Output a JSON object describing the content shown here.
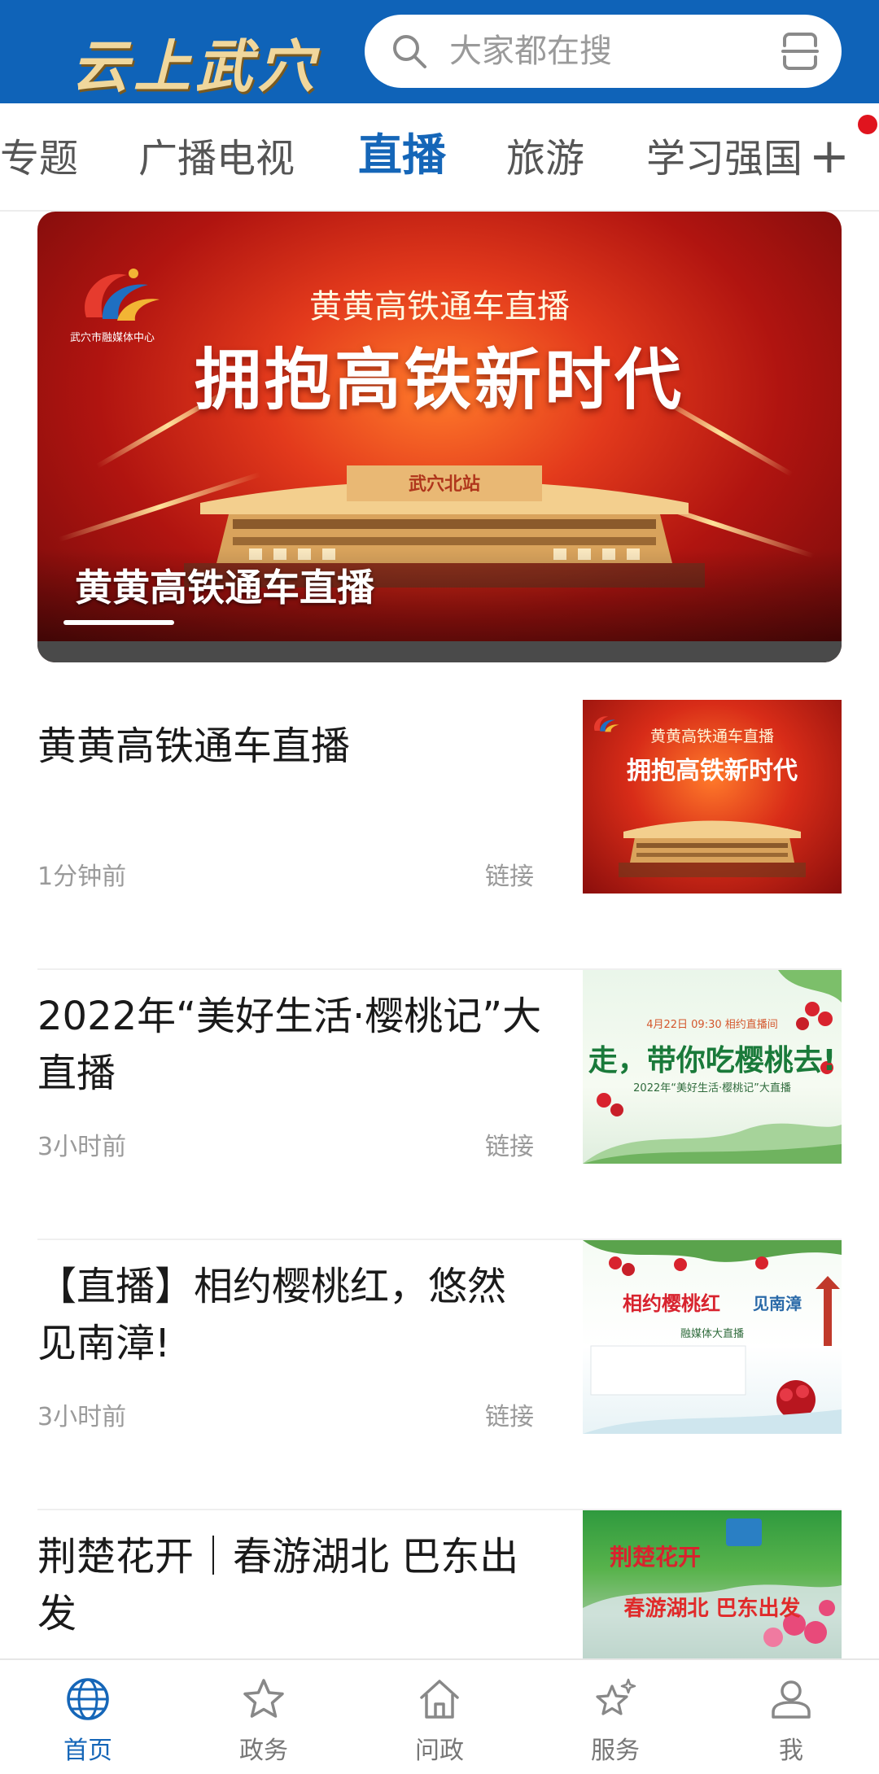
{
  "header": {
    "logo_text": "云上武穴",
    "search_placeholder": "大家都在搜"
  },
  "tabs": [
    {
      "label": "专题",
      "active": false
    },
    {
      "label": "广播电视",
      "active": false
    },
    {
      "label": "直播",
      "active": true
    },
    {
      "label": "旅游",
      "active": false
    },
    {
      "label": "学习强国",
      "active": false
    }
  ],
  "tabs_add": "+",
  "banner": {
    "logo_text": "武穴市融媒体中心",
    "subtitle": "黄黄高铁通车直播",
    "title": "拥抱高铁新时代",
    "station_sign": "武穴北站",
    "caption": "黄黄高铁通车直播"
  },
  "news": [
    {
      "title": "黄黄高铁通车直播",
      "time": "1分钟前",
      "tag": "链接",
      "thumb": {
        "line1": "黄黄高铁通车直播",
        "line2": "拥抱高铁新时代"
      }
    },
    {
      "title": "2022年“美好生活·樱桃记”大直播",
      "time": "3小时前",
      "tag": "链接",
      "thumb": {
        "line1": "4月22日 09:30 相约直播间",
        "line2": "走，带你吃樱桃去!",
        "line3": "2022年“美好生活·樱桃记”大直播"
      }
    },
    {
      "title": "【直播】相约樱桃红，悠然见南漳!",
      "time": "3小时前",
      "tag": "链接",
      "thumb": {
        "line1": "相约樱桃红",
        "line2": "见南漳",
        "line3": "融媒体大直播"
      }
    },
    {
      "title": "荆楚花开｜春游湖北 巴东出发",
      "time": "",
      "tag": "",
      "thumb": {
        "line1": "荆楚花开",
        "line2": "春游湖北 巴东出发"
      }
    }
  ],
  "bottom_nav": [
    {
      "label": "首页",
      "icon": "globe-icon",
      "active": true
    },
    {
      "label": "政务",
      "icon": "star-icon",
      "active": false
    },
    {
      "label": "问政",
      "icon": "home-icon",
      "active": false
    },
    {
      "label": "服务",
      "icon": "sparkle-star-icon",
      "active": false
    },
    {
      "label": "我",
      "icon": "user-icon",
      "active": false
    }
  ],
  "colors": {
    "header_bg": "#0f63b8",
    "active_tab": "#1566b8",
    "logo_gold": "#f0d79c",
    "notification_dot": "#e0141e"
  }
}
